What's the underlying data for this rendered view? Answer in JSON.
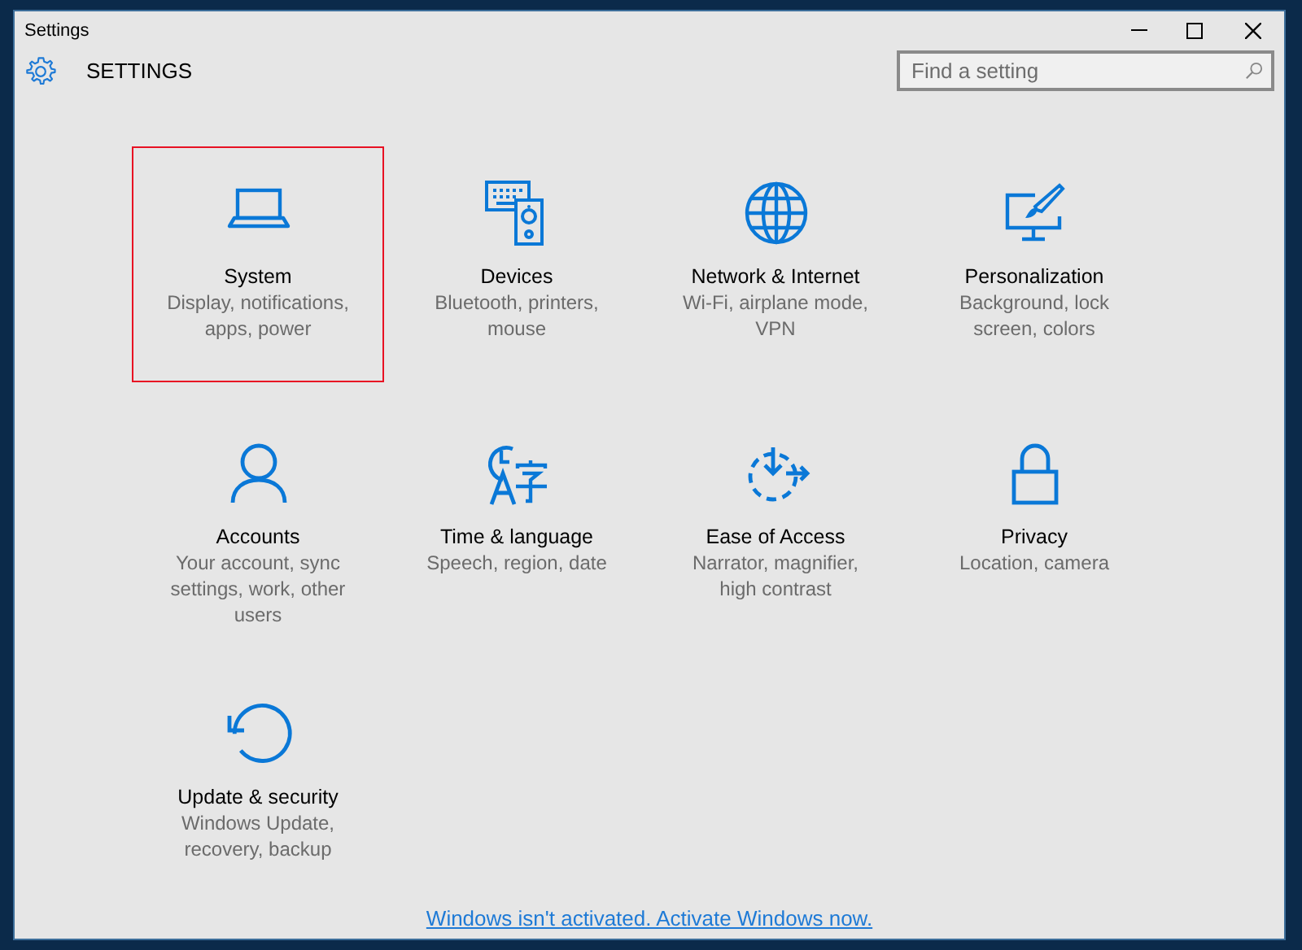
{
  "window": {
    "title": "Settings"
  },
  "header": {
    "title": "SETTINGS"
  },
  "search": {
    "placeholder": "Find a setting"
  },
  "categories": [
    {
      "kind": "laptop",
      "title": "System",
      "description": "Display, notifications, apps, power",
      "selected": true
    },
    {
      "kind": "devices",
      "title": "Devices",
      "description": "Bluetooth, printers, mouse",
      "selected": false
    },
    {
      "kind": "globe",
      "title": "Network & Internet",
      "description": "Wi-Fi, airplane mode, VPN",
      "selected": false
    },
    {
      "kind": "paint",
      "title": "Personalization",
      "description": "Background, lock screen, colors",
      "selected": false
    },
    {
      "kind": "person",
      "title": "Accounts",
      "description": "Your account, sync settings, work, other users",
      "selected": false
    },
    {
      "kind": "language",
      "title": "Time & language",
      "description": "Speech, region, date",
      "selected": false
    },
    {
      "kind": "ease",
      "title": "Ease of Access",
      "description": "Narrator, magnifier, high contrast",
      "selected": false
    },
    {
      "kind": "lock",
      "title": "Privacy",
      "description": "Location, camera",
      "selected": false
    },
    {
      "kind": "update",
      "title": "Update & security",
      "description": "Windows Update, recovery, backup",
      "selected": false
    }
  ],
  "activation_link": "Windows isn't activated. Activate Windows now."
}
